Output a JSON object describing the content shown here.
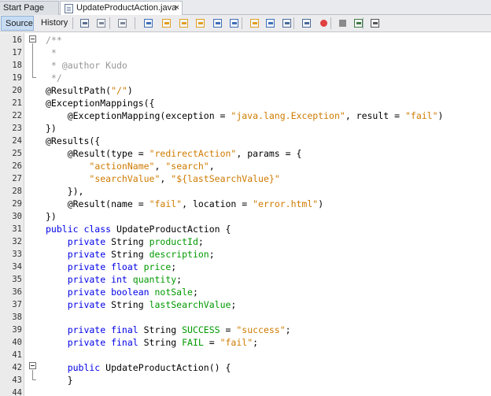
{
  "tabs": [
    {
      "label": "Start Page"
    },
    {
      "label": "UpdateProductAction.java",
      "close": "×"
    }
  ],
  "toolbar": {
    "source_label": "Source",
    "history_label": "History",
    "icons": [
      "last-edit-icon",
      "back-icon",
      "forward-icon",
      "find-icon",
      "find-previous-icon",
      "find-next-icon",
      "toggle-highlight-icon",
      "find-selection-icon",
      "previous-bookmark-icon",
      "next-bookmark-icon",
      "toggle-bookmark-icon",
      "shift-left-icon",
      "shift-right-icon",
      "macro-record-icon",
      "macro-stop-icon",
      "comment-icon",
      "uncomment-icon"
    ]
  },
  "lines": [
    {
      "no": "16",
      "tokens": [
        {
          "t": "/**",
          "c": "cm"
        }
      ]
    },
    {
      "no": "17",
      "tokens": [
        {
          "t": " *",
          "c": "cm"
        }
      ]
    },
    {
      "no": "18",
      "tokens": [
        {
          "t": " * @author Kudo",
          "c": "cm"
        }
      ]
    },
    {
      "no": "19",
      "tokens": [
        {
          "t": " */",
          "c": "cm"
        }
      ]
    },
    {
      "no": "20",
      "tokens": [
        {
          "t": "@ResultPath(",
          "c": "ann"
        },
        {
          "t": "\"/\"",
          "c": "str"
        },
        {
          "t": ")",
          "c": "ann"
        }
      ]
    },
    {
      "no": "21",
      "tokens": [
        {
          "t": "@ExceptionMappings({",
          "c": "ann"
        }
      ]
    },
    {
      "no": "22",
      "tokens": [
        {
          "t": "    @ExceptionMapping(exception = ",
          "c": "ann"
        },
        {
          "t": "\"java.lang.Exception\"",
          "c": "str"
        },
        {
          "t": ", result = ",
          "c": "ann"
        },
        {
          "t": "\"fail\"",
          "c": "str"
        },
        {
          "t": ")",
          "c": "ann"
        }
      ]
    },
    {
      "no": "23",
      "tokens": [
        {
          "t": "})",
          "c": "ann"
        }
      ]
    },
    {
      "no": "24",
      "tokens": [
        {
          "t": "@Results({",
          "c": "ann"
        }
      ]
    },
    {
      "no": "25",
      "tokens": [
        {
          "t": "    @Result(type = ",
          "c": "ann"
        },
        {
          "t": "\"redirectAction\"",
          "c": "str"
        },
        {
          "t": ", params = {",
          "c": "ann"
        }
      ]
    },
    {
      "no": "26",
      "tokens": [
        {
          "t": "        ",
          "c": "ann"
        },
        {
          "t": "\"actionName\"",
          "c": "str"
        },
        {
          "t": ", ",
          "c": "ann"
        },
        {
          "t": "\"search\"",
          "c": "str"
        },
        {
          "t": ",",
          "c": "ann"
        }
      ]
    },
    {
      "no": "27",
      "tokens": [
        {
          "t": "        ",
          "c": "ann"
        },
        {
          "t": "\"searchValue\"",
          "c": "str"
        },
        {
          "t": ", ",
          "c": "ann"
        },
        {
          "t": "\"${lastSearchValue}\"",
          "c": "str"
        }
      ]
    },
    {
      "no": "28",
      "tokens": [
        {
          "t": "    }),",
          "c": "ann"
        }
      ]
    },
    {
      "no": "29",
      "tokens": [
        {
          "t": "    @Result(name = ",
          "c": "ann"
        },
        {
          "t": "\"fail\"",
          "c": "str"
        },
        {
          "t": ", location = ",
          "c": "ann"
        },
        {
          "t": "\"error.html\"",
          "c": "str"
        },
        {
          "t": ")",
          "c": "ann"
        }
      ]
    },
    {
      "no": "30",
      "tokens": [
        {
          "t": "})",
          "c": "ann"
        }
      ]
    },
    {
      "no": "31",
      "tokens": [
        {
          "t": "public class ",
          "c": "kw"
        },
        {
          "t": "UpdateProductAction {",
          "c": "ann"
        }
      ]
    },
    {
      "no": "32",
      "tokens": [
        {
          "t": "    private ",
          "c": "kw"
        },
        {
          "t": "String ",
          "c": "ann"
        },
        {
          "t": "productId",
          "c": "fld"
        },
        {
          "t": ";",
          "c": "ann"
        }
      ]
    },
    {
      "no": "33",
      "tokens": [
        {
          "t": "    private ",
          "c": "kw"
        },
        {
          "t": "String ",
          "c": "ann"
        },
        {
          "t": "description",
          "c": "fld"
        },
        {
          "t": ";",
          "c": "ann"
        }
      ]
    },
    {
      "no": "34",
      "tokens": [
        {
          "t": "    private float ",
          "c": "kw"
        },
        {
          "t": "price",
          "c": "fld"
        },
        {
          "t": ";",
          "c": "ann"
        }
      ]
    },
    {
      "no": "35",
      "tokens": [
        {
          "t": "    private int ",
          "c": "kw"
        },
        {
          "t": "quantity",
          "c": "fld"
        },
        {
          "t": ";",
          "c": "ann"
        }
      ]
    },
    {
      "no": "36",
      "tokens": [
        {
          "t": "    private boolean ",
          "c": "kw"
        },
        {
          "t": "notSale",
          "c": "fld"
        },
        {
          "t": ";",
          "c": "ann"
        }
      ]
    },
    {
      "no": "37",
      "tokens": [
        {
          "t": "    private ",
          "c": "kw"
        },
        {
          "t": "String ",
          "c": "ann"
        },
        {
          "t": "lastSearchValue",
          "c": "fld"
        },
        {
          "t": ";",
          "c": "ann"
        }
      ]
    },
    {
      "no": "38",
      "tokens": []
    },
    {
      "no": "39",
      "tokens": [
        {
          "t": "    private final ",
          "c": "kw"
        },
        {
          "t": "String ",
          "c": "ann"
        },
        {
          "t": "SUCCESS",
          "c": "fld"
        },
        {
          "t": " = ",
          "c": "ann"
        },
        {
          "t": "\"success\"",
          "c": "str"
        },
        {
          "t": ";",
          "c": "ann"
        }
      ]
    },
    {
      "no": "40",
      "tokens": [
        {
          "t": "    private final ",
          "c": "kw"
        },
        {
          "t": "String ",
          "c": "ann"
        },
        {
          "t": "FAIL",
          "c": "fld"
        },
        {
          "t": " = ",
          "c": "ann"
        },
        {
          "t": "\"fail\"",
          "c": "str"
        },
        {
          "t": ";",
          "c": "ann"
        }
      ]
    },
    {
      "no": "41",
      "tokens": []
    },
    {
      "no": "42",
      "tokens": [
        {
          "t": "    public ",
          "c": "kw"
        },
        {
          "t": "UpdateProductAction() {",
          "c": "ann"
        }
      ]
    },
    {
      "no": "43",
      "tokens": [
        {
          "t": "    }",
          "c": "ann"
        }
      ]
    },
    {
      "no": "44",
      "tokens": []
    }
  ],
  "colors": {
    "keyword": "#0000e6",
    "string": "#ce7b00",
    "comment": "#969696",
    "field": "#009900"
  }
}
